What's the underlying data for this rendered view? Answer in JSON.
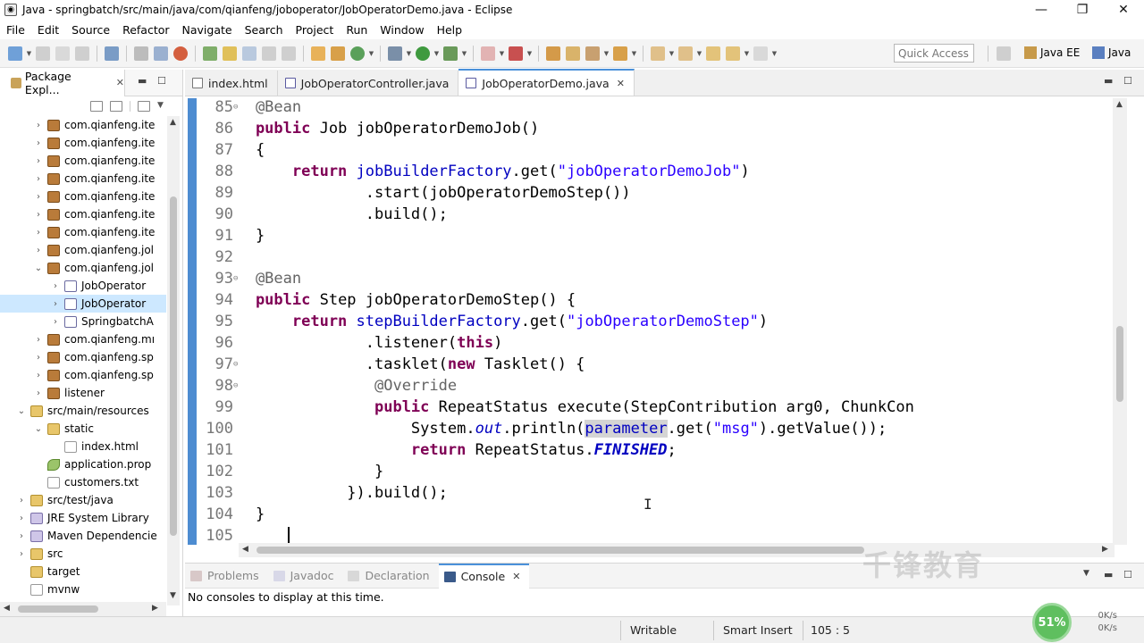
{
  "window": {
    "title": "Java - springbatch/src/main/java/com/qianfeng/joboperator/JobOperatorDemo.java - Eclipse",
    "controls": [
      "—",
      "❐",
      "✕"
    ]
  },
  "menu": [
    "File",
    "Edit",
    "Source",
    "Refactor",
    "Navigate",
    "Search",
    "Project",
    "Run",
    "Window",
    "Help"
  ],
  "toolbar": {
    "quick_access_placeholder": "Quick Access",
    "perspectives": [
      "Java EE",
      "Java"
    ]
  },
  "package_explorer": {
    "tab_label": "Package Expl...",
    "items": [
      {
        "label": "com.qianfeng.ite",
        "indent": 1,
        "arrow": "›",
        "icon": "pkg"
      },
      {
        "label": "com.qianfeng.ite",
        "indent": 1,
        "arrow": "›",
        "icon": "pkg"
      },
      {
        "label": "com.qianfeng.ite",
        "indent": 1,
        "arrow": "›",
        "icon": "pkg"
      },
      {
        "label": "com.qianfeng.ite",
        "indent": 1,
        "arrow": "›",
        "icon": "pkg"
      },
      {
        "label": "com.qianfeng.ite",
        "indent": 1,
        "arrow": "›",
        "icon": "pkg"
      },
      {
        "label": "com.qianfeng.ite",
        "indent": 1,
        "arrow": "›",
        "icon": "pkg"
      },
      {
        "label": "com.qianfeng.ite",
        "indent": 1,
        "arrow": "›",
        "icon": "pkg"
      },
      {
        "label": "com.qianfeng.jol",
        "indent": 1,
        "arrow": "›",
        "icon": "pkg"
      },
      {
        "label": "com.qianfeng.jol",
        "indent": 1,
        "arrow": "⌄",
        "icon": "pkg"
      },
      {
        "label": "JobOperator",
        "indent": 2,
        "arrow": "›",
        "icon": "java"
      },
      {
        "label": "JobOperator",
        "indent": 2,
        "arrow": "›",
        "icon": "java",
        "selected": true
      },
      {
        "label": "SpringbatchA",
        "indent": 2,
        "arrow": "›",
        "icon": "java"
      },
      {
        "label": "com.qianfeng.mı",
        "indent": 1,
        "arrow": "›",
        "icon": "pkg"
      },
      {
        "label": "com.qianfeng.sp",
        "indent": 1,
        "arrow": "›",
        "icon": "pkg"
      },
      {
        "label": "com.qianfeng.sp",
        "indent": 1,
        "arrow": "›",
        "icon": "pkg"
      },
      {
        "label": "listener",
        "indent": 1,
        "arrow": "›",
        "icon": "pkg"
      },
      {
        "label": "src/main/resources",
        "indent": 0,
        "arrow": "⌄",
        "icon": "folder"
      },
      {
        "label": "static",
        "indent": 1,
        "arrow": "⌄",
        "icon": "folder"
      },
      {
        "label": "index.html",
        "indent": 2,
        "arrow": "",
        "icon": "file"
      },
      {
        "label": "application.prop",
        "indent": 1,
        "arrow": "",
        "icon": "leaf"
      },
      {
        "label": "customers.txt",
        "indent": 1,
        "arrow": "",
        "icon": "file"
      },
      {
        "label": "src/test/java",
        "indent": 0,
        "arrow": "›",
        "icon": "folder"
      },
      {
        "label": "JRE System Library",
        "indent": 0,
        "arrow": "›",
        "icon": "lib"
      },
      {
        "label": "Maven Dependencie",
        "indent": 0,
        "arrow": "›",
        "icon": "lib"
      },
      {
        "label": "src",
        "indent": 0,
        "arrow": "›",
        "icon": "folder"
      },
      {
        "label": "target",
        "indent": 0,
        "arrow": "",
        "icon": "folder"
      },
      {
        "label": "mvnw",
        "indent": 0,
        "arrow": "",
        "icon": "file"
      }
    ]
  },
  "editor": {
    "tabs": [
      {
        "label": "index.html",
        "active": false
      },
      {
        "label": "JobOperatorController.java",
        "active": false
      },
      {
        "label": "JobOperatorDemo.java",
        "active": true
      }
    ],
    "lines": [
      {
        "n": "85",
        "fold": "⊖",
        "tokens": [
          [
            "ann",
            "    @Bean"
          ]
        ]
      },
      {
        "n": "86",
        "fold": "",
        "tokens": [
          [
            "kw",
            "    public"
          ],
          [
            "",
            " Job jobOperatorDemoJob()"
          ]
        ]
      },
      {
        "n": "87",
        "fold": "",
        "tokens": [
          [
            "",
            "    {"
          ]
        ]
      },
      {
        "n": "88",
        "fold": "",
        "tokens": [
          [
            "kw",
            "        return"
          ],
          [
            "",
            " "
          ],
          [
            "fld",
            "jobBuilderFactory"
          ],
          [
            "",
            ".get("
          ],
          [
            "str",
            "\"jobOperatorDemoJob\""
          ],
          [
            "",
            ")"
          ]
        ]
      },
      {
        "n": "89",
        "fold": "",
        "tokens": [
          [
            "",
            "                .start(jobOperatorDemoStep())"
          ]
        ]
      },
      {
        "n": "90",
        "fold": "",
        "tokens": [
          [
            "",
            "                .build();"
          ]
        ]
      },
      {
        "n": "91",
        "fold": "",
        "tokens": [
          [
            "",
            "    }"
          ]
        ]
      },
      {
        "n": "92",
        "fold": "",
        "tokens": [
          [
            "",
            ""
          ]
        ]
      },
      {
        "n": "93",
        "fold": "⊖",
        "tokens": [
          [
            "ann",
            "    @Bean"
          ]
        ]
      },
      {
        "n": "94",
        "fold": "",
        "tokens": [
          [
            "kw",
            "    public"
          ],
          [
            "",
            " Step jobOperatorDemoStep() {"
          ]
        ]
      },
      {
        "n": "95",
        "fold": "",
        "tokens": [
          [
            "kw",
            "        return"
          ],
          [
            "",
            " "
          ],
          [
            "fld",
            "stepBuilderFactory"
          ],
          [
            "",
            ".get("
          ],
          [
            "str",
            "\"jobOperatorDemoStep\""
          ],
          [
            "",
            ")"
          ]
        ]
      },
      {
        "n": "96",
        "fold": "",
        "tokens": [
          [
            "",
            "                .listener("
          ],
          [
            "kw",
            "this"
          ],
          [
            "",
            ")"
          ]
        ]
      },
      {
        "n": "97",
        "fold": "⊖",
        "tokens": [
          [
            "",
            "                .tasklet("
          ],
          [
            "kw",
            "new"
          ],
          [
            "",
            " Tasklet() {"
          ]
        ]
      },
      {
        "n": "98",
        "fold": "⊖",
        "tokens": [
          [
            "ann",
            "                 @Override"
          ]
        ]
      },
      {
        "n": "99",
        "fold": "",
        "tokens": [
          [
            "kw",
            "                 public"
          ],
          [
            "",
            " RepeatStatus execute(StepContribution arg0, ChunkCon"
          ]
        ]
      },
      {
        "n": "100",
        "fold": "",
        "tokens": [
          [
            "",
            "                     System."
          ],
          [
            "sfld",
            "out"
          ],
          [
            "",
            ".println("
          ],
          [
            "fld hl",
            "parameter"
          ],
          [
            "",
            ".get("
          ],
          [
            "str",
            "\"msg\""
          ],
          [
            "",
            ").getValue());"
          ]
        ]
      },
      {
        "n": "101",
        "fold": "",
        "tokens": [
          [
            "kw",
            "                     return"
          ],
          [
            "",
            " RepeatStatus."
          ],
          [
            "static",
            "FINISHED"
          ],
          [
            "",
            ";"
          ]
        ]
      },
      {
        "n": "102",
        "fold": "",
        "tokens": [
          [
            "",
            "                 }"
          ]
        ]
      },
      {
        "n": "103",
        "fold": "",
        "tokens": [
          [
            "",
            "              }).build();"
          ]
        ]
      },
      {
        "n": "104",
        "fold": "",
        "tokens": [
          [
            "",
            "    }"
          ]
        ]
      },
      {
        "n": "105",
        "fold": "",
        "tokens": [
          [
            "",
            ""
          ]
        ]
      }
    ]
  },
  "console": {
    "tabs": [
      "Problems",
      "Javadoc",
      "Declaration",
      "Console"
    ],
    "active_tab": "Console",
    "message": "No consoles to display at this time."
  },
  "status": {
    "mode": "Writable",
    "insert": "Smart Insert",
    "position": "105 : 5"
  },
  "overlay": {
    "watermark": "千锋教育",
    "cpu_badge": "51%",
    "net_up": "0K/s",
    "net_down": "0K/s"
  }
}
